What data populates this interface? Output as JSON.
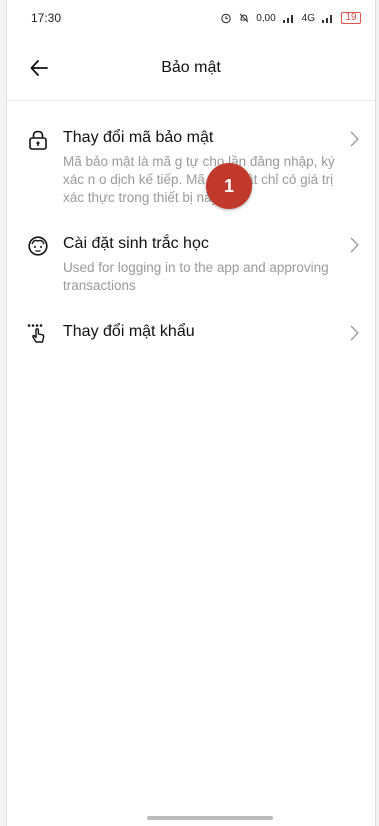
{
  "status_bar": {
    "time": "17:30",
    "net_speed": "0,00\nKB/S",
    "network": "4G",
    "battery": "19"
  },
  "header": {
    "title": "Bảo mật",
    "back_icon": "arrow-left-icon"
  },
  "menu": [
    {
      "icon": "lock-icon",
      "title": "Thay đổi mã bảo mật",
      "description": "Mã bảo mật là mã g tự cho lần đăng nhập, ký xác n o dịch kế tiếp. Mã bảo mật chỉ có giá trị xác thực trong thiết bị này."
    },
    {
      "icon": "face-icon",
      "title": "Cài đặt sinh trắc học",
      "description": "Used for logging in to the app and approving transactions"
    },
    {
      "icon": "tap-password-icon",
      "title": "Thay đổi mật khẩu",
      "description": ""
    }
  ],
  "annotation_badge": "1"
}
